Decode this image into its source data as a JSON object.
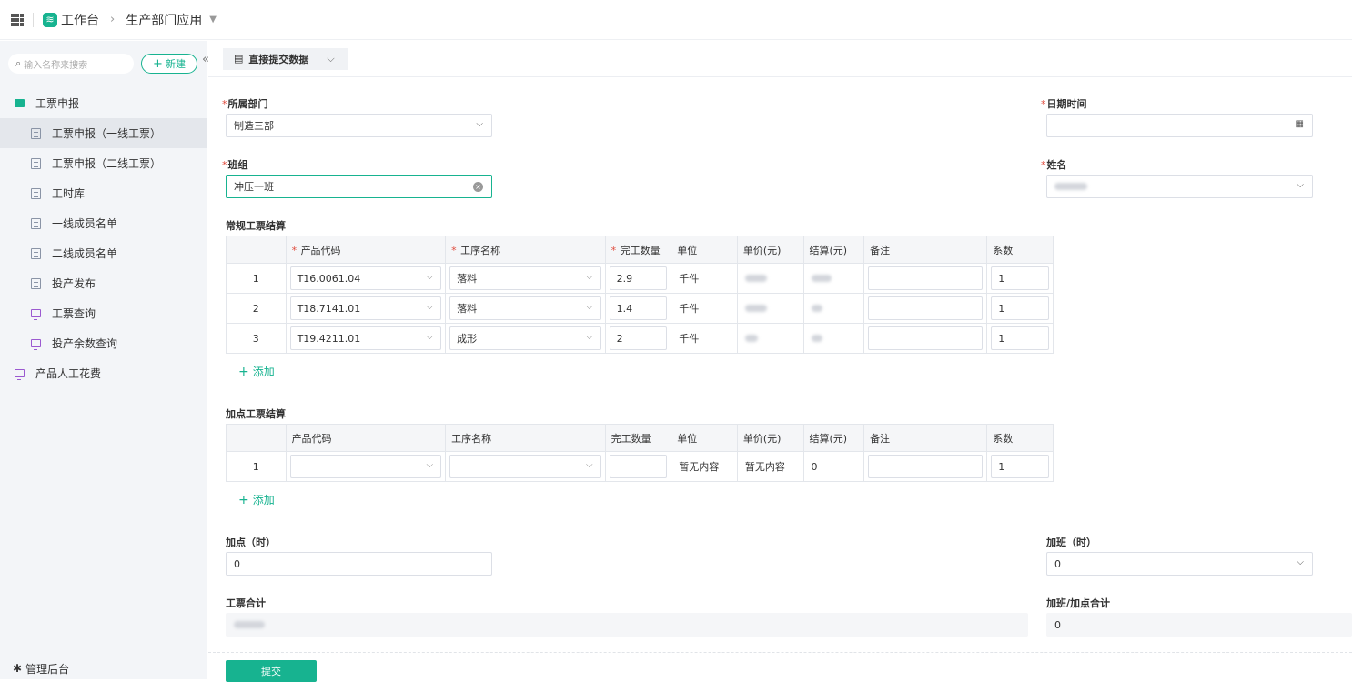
{
  "topbar": {
    "workspace": "工作台",
    "app_name": "生产部门应用"
  },
  "sidebar": {
    "search_placeholder": "输入名称来搜索",
    "new_label": "新建",
    "items": [
      {
        "label": "工票申报",
        "type": "folder",
        "level": 0
      },
      {
        "label": "工票申报（一线工票）",
        "type": "form",
        "level": 1,
        "active": true
      },
      {
        "label": "工票申报（二线工票）",
        "type": "form",
        "level": 1
      },
      {
        "label": "工时库",
        "type": "form",
        "level": 1
      },
      {
        "label": "一线成员名单",
        "type": "form",
        "level": 1
      },
      {
        "label": "二线成员名单",
        "type": "form",
        "level": 1
      },
      {
        "label": "投产发布",
        "type": "form",
        "level": 1
      },
      {
        "label": "工票查询",
        "type": "dashboard",
        "level": 1
      },
      {
        "label": "投产余数查询",
        "type": "dashboard",
        "level": 1
      },
      {
        "label": "产品人工花费",
        "type": "dashboard",
        "level": 0
      }
    ],
    "admin_label": "管理后台"
  },
  "toolbar": {
    "mode_label": "直接提交数据"
  },
  "form": {
    "department": {
      "label": "所属部门",
      "value": "制造三部"
    },
    "datetime": {
      "label": "日期时间",
      "value": ""
    },
    "team": {
      "label": "班组",
      "value": "冲压一班"
    },
    "name": {
      "label": "姓名"
    },
    "regular": {
      "title": "常规工票结算",
      "headers": [
        "产品代码",
        "工序名称",
        "完工数量",
        "单位",
        "单价(元)",
        "结算(元)",
        "备注",
        "系数"
      ],
      "rows": [
        {
          "idx": "1",
          "code": "T16.0061.04",
          "process": "落料",
          "qty": "2.9",
          "unit": "千件",
          "note": "",
          "coef": "1"
        },
        {
          "idx": "2",
          "code": "T18.7141.01",
          "process": "落料",
          "qty": "1.4",
          "unit": "千件",
          "note": "",
          "coef": "1"
        },
        {
          "idx": "3",
          "code": "T19.4211.01",
          "process": "成形",
          "qty": "2",
          "unit": "千件",
          "note": "",
          "coef": "1"
        }
      ],
      "add_label": "添加"
    },
    "overtime_points": {
      "title": "加点工票结算",
      "headers": [
        "产品代码",
        "工序名称",
        "完工数量",
        "单位",
        "单价(元)",
        "结算(元)",
        "备注",
        "系数"
      ],
      "rows": [
        {
          "idx": "1",
          "code": "",
          "process": "",
          "qty": "",
          "unit": "暂无内容",
          "price": "暂无内容",
          "total": "0",
          "note": "",
          "coef": "1"
        }
      ],
      "add_label": "添加"
    },
    "extra_hours": {
      "label": "加点（时）",
      "value": "0"
    },
    "overtime_hours": {
      "label": "加班（时）",
      "value": "0"
    },
    "ticket_total": {
      "label": "工票合计"
    },
    "overtime_total": {
      "label": "加班/加点合计",
      "value": "0"
    }
  },
  "submit_label": "提交",
  "colors": {
    "accent": "#17b390",
    "required": "#e04a3c"
  }
}
